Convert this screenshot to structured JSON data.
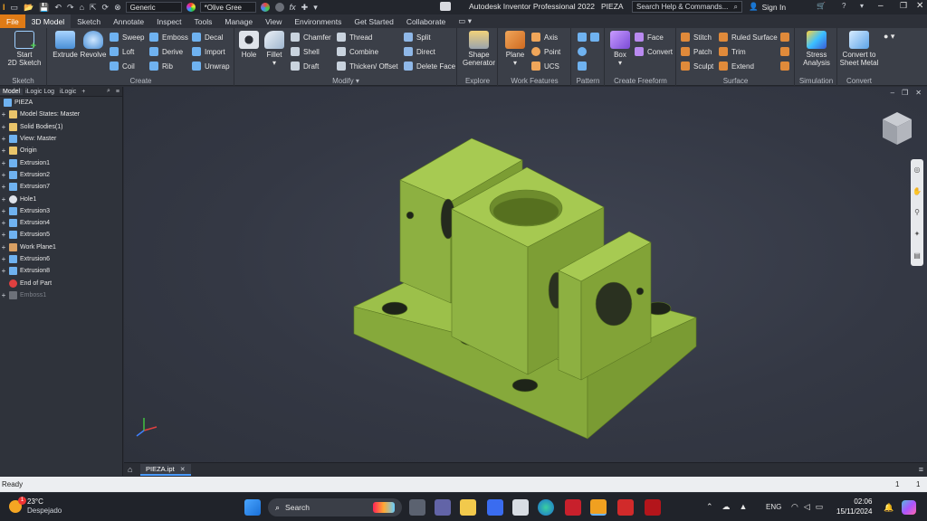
{
  "titlebar": {
    "app_title": "Autodesk Inventor Professional 2022",
    "doc_name": "PIEZA",
    "appearance_dropdown": "Generic",
    "material_dropdown": "*Olive Gree",
    "fx_label": "fx",
    "search_placeholder": "Search Help & Commands...",
    "signin_label": "Sign In"
  },
  "tabs": [
    "File",
    "3D Model",
    "Sketch",
    "Annotate",
    "Inspect",
    "Tools",
    "Manage",
    "View",
    "Environments",
    "Get Started",
    "Collaborate"
  ],
  "ribbon": {
    "sketch": {
      "start_line1": "Start",
      "start_line2": "2D Sketch",
      "panel": "Sketch"
    },
    "create": {
      "extrude": "Extrude",
      "revolve": "Revolve",
      "sweep": "Sweep",
      "loft": "Loft",
      "coil": "Coil",
      "emboss": "Emboss",
      "derive": "Derive",
      "rib": "Rib",
      "decal": "Decal",
      "import": "Import",
      "unwrap": "Unwrap",
      "panel": "Create"
    },
    "modify": {
      "hole": "Hole",
      "fillet": "Fillet",
      "chamfer": "Chamfer",
      "shell": "Shell",
      "draft": "Draft",
      "thread": "Thread",
      "combine": "Combine",
      "thicken": "Thicken/ Offset",
      "split": "Split",
      "direct": "Direct",
      "delete_face": "Delete Face",
      "panel": "Modify ▾"
    },
    "explore": {
      "shape1": "Shape",
      "shape2": "Generator",
      "panel": "Explore"
    },
    "work": {
      "plane": "Plane",
      "axis": "Axis",
      "point": "Point",
      "ucs": "UCS",
      "panel": "Work Features"
    },
    "pattern": {
      "panel": "Pattern"
    },
    "freeform": {
      "box": "Box",
      "face": "Face",
      "convert": "Convert",
      "panel": "Create Freeform"
    },
    "surface": {
      "stitch": "Stitch",
      "patch": "Patch",
      "sculpt": "Sculpt",
      "ruled": "Ruled Surface",
      "trim": "Trim",
      "extend": "Extend",
      "panel": "Surface"
    },
    "simulation": {
      "stress1": "Stress",
      "stress2": "Analysis",
      "panel": "Simulation"
    },
    "convert": {
      "c1": "Convert to",
      "c2": "Sheet Metal",
      "panel": "Convert"
    }
  },
  "browser": {
    "tabs": [
      "Model",
      "iLogic Log",
      "iLogic"
    ],
    "root": "PIEZA",
    "items": [
      {
        "label": "Model States: Master",
        "icon": "folder"
      },
      {
        "label": "Solid Bodies(1)",
        "icon": "folder"
      },
      {
        "label": "View: Master",
        "icon": "view"
      },
      {
        "label": "Origin",
        "icon": "folder"
      },
      {
        "label": "Extrusion1",
        "icon": "feature"
      },
      {
        "label": "Extrusion2",
        "icon": "feature"
      },
      {
        "label": "Extrusion7",
        "icon": "feature"
      },
      {
        "label": "Hole1",
        "icon": "hole"
      },
      {
        "label": "Extrusion3",
        "icon": "feature"
      },
      {
        "label": "Extrusion4",
        "icon": "feature"
      },
      {
        "label": "Extrusion5",
        "icon": "feature"
      },
      {
        "label": "Work Plane1",
        "icon": "plane"
      },
      {
        "label": "Extrusion6",
        "icon": "feature"
      },
      {
        "label": "Extrusion8",
        "icon": "feature"
      },
      {
        "label": "End of Part",
        "icon": "end"
      },
      {
        "label": "Emboss1",
        "icon": "disabled"
      }
    ]
  },
  "doc_tab": "PIEZA.ipt",
  "status": {
    "text": "Ready",
    "n1": "1",
    "n2": "1"
  },
  "taskbar": {
    "temp": "23°C",
    "weather": "Despejado",
    "badge": "1",
    "search": "Search",
    "lang": "ENG",
    "time": "02:06",
    "date": "15/11/2024"
  },
  "colors": {
    "part": "#8fb342",
    "accent": "#e07b16"
  }
}
